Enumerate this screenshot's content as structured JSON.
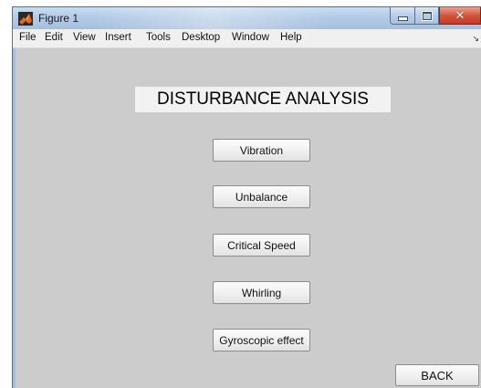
{
  "window": {
    "title": "Figure 1"
  },
  "menu": {
    "items": [
      "File",
      "Edit",
      "View",
      "Insert",
      "Tools",
      "Desktop",
      "Window",
      "Help"
    ]
  },
  "main": {
    "heading": "DISTURBANCE ANALYSIS",
    "buttons": [
      "Vibration",
      "Unbalance",
      "Critical Speed",
      "Whirling",
      "Gyroscopic effect"
    ],
    "back_label": "BACK"
  },
  "colors": {
    "client_background": "#cccccc",
    "heading_background": "#f2f2f2",
    "titlebar": "#b3cbe6",
    "close_button": "#c43a20"
  },
  "icons": {
    "app": "matlab-icon",
    "minimize": "minimize-icon",
    "maximize": "maximize-icon",
    "close": "close-icon",
    "menu_overflow": "chevron-right-icon"
  }
}
